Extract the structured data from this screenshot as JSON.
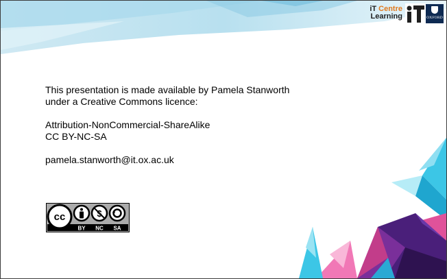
{
  "logo": {
    "line1_a": "iT",
    "line1_b": "Centre",
    "line2": "Learning",
    "services_text": "OXFORD"
  },
  "content": {
    "line1": "This presentation is made available by Pamela Stanworth",
    "line2": "under a Creative Commons licence:",
    "licence_name": "Attribution-NonCommercial-ShareAlike",
    "licence_code": "CC BY-NC-SA",
    "email": "pamela.stanworth@it.ox.ac.uk"
  },
  "cc_badge": {
    "cc": "cc",
    "by": "BY",
    "nc": "NC",
    "sa": "SA"
  },
  "colors": {
    "header_blue": "#9fd3ea",
    "accent_orange": "#e07a1f",
    "oxford_navy": "#0e2a52",
    "deco_purple": "#5a2a8a",
    "deco_pink": "#e0529a",
    "deco_cyan": "#3cc6e6"
  }
}
